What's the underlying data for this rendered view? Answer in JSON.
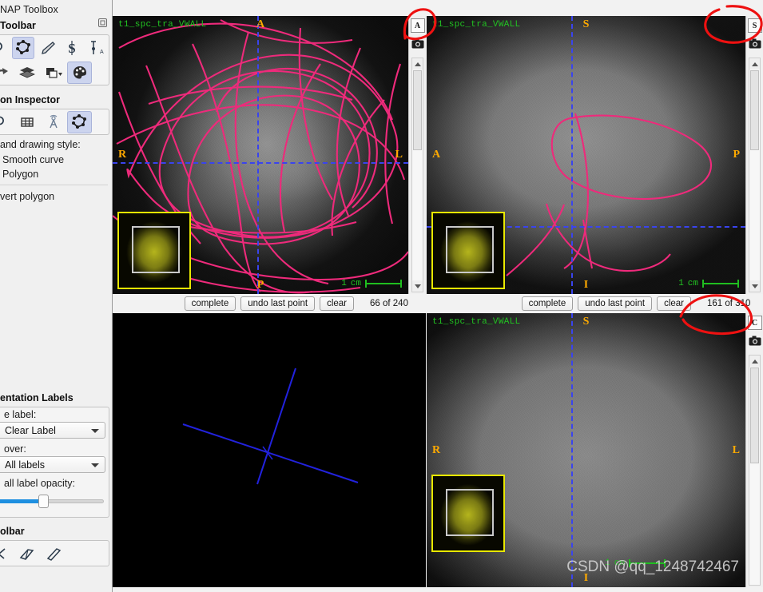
{
  "left_panel": {
    "window_title": "NAP Toolbox",
    "main_toolbar_header": "Toolbar",
    "main_toolbar_tools": [
      {
        "name": "crosshair-zoom-tool",
        "icon": "magnifier-icon",
        "selected": false
      },
      {
        "name": "polygon-tool",
        "icon": "polygon-icon",
        "selected": true
      },
      {
        "name": "paintbrush-tool",
        "icon": "paintbrush-icon",
        "selected": false
      },
      {
        "name": "snake-tool",
        "icon": "snake-s-icon",
        "selected": false
      },
      {
        "name": "annotation-tool",
        "icon": "ruler-ab-icon",
        "selected": false
      }
    ],
    "main_toolbar_tools_row2": [
      {
        "name": "redo-button",
        "icon": "arrow-right-icon",
        "selected": false
      },
      {
        "name": "layers-button",
        "icon": "layers-icon",
        "selected": false
      },
      {
        "name": "layout-button",
        "icon": "copy-dropdown-icon",
        "selected": false
      },
      {
        "name": "palette-button",
        "icon": "palette-icon",
        "selected": true
      }
    ],
    "inspector_header": "on Inspector",
    "inspector_tabs": [
      {
        "name": "inspector-tab-zoom",
        "icon": "magnifier-icon",
        "selected": false
      },
      {
        "name": "inspector-tab-grid",
        "icon": "grid-icon",
        "selected": false
      },
      {
        "name": "inspector-tab-contrast",
        "icon": "antenna-icon",
        "selected": false
      },
      {
        "name": "inspector-tab-polygon",
        "icon": "polygon-icon",
        "selected": true
      }
    ],
    "drawing_style_label": "and drawing style:",
    "radio_smooth": "Smooth curve",
    "radio_polygon": "Polygon",
    "invert_polygon": "vert polygon",
    "labels_header": "entation Labels",
    "active_label_caption": "e label:",
    "active_label_value": "Clear Label",
    "paint_over_caption": "over:",
    "paint_over_value": "All labels",
    "opacity_caption": "all label opacity:",
    "opacity_percent": 47,
    "bottom_toolbar_header": "olbar",
    "bottom_tools": [
      {
        "name": "crosshair-3d-tool",
        "icon": "crosshair-icon"
      },
      {
        "name": "scalpel-tool",
        "icon": "scalpel-icon"
      },
      {
        "name": "spray-tool",
        "icon": "spray-icon"
      }
    ]
  },
  "views": {
    "axial": {
      "image_label": "t1_spc_tra_VWALL",
      "orientation": {
        "top": "A",
        "bottom": "P",
        "left": "R",
        "right": "L"
      },
      "scale_text": "1",
      "scale_unit": "cm",
      "strip_letter": "A",
      "camera_icon": "camera-icon",
      "slice_counter": "66 of 240",
      "buttons": {
        "complete": "complete",
        "undo": "undo last point",
        "clear": "clear"
      }
    },
    "sagittal": {
      "image_label": "t1_spc_tra_VWALL",
      "orientation": {
        "top": "S",
        "bottom": "I",
        "left": "A",
        "right": "P"
      },
      "scale_text": "1",
      "scale_unit": "cm",
      "strip_letter": "S",
      "camera_icon": "camera-icon",
      "slice_counter": "161 of 310",
      "buttons": {
        "complete": "complete",
        "undo": "undo last point",
        "clear": "clear"
      }
    },
    "three_d": {
      "name": "3d-render-view"
    },
    "coronal": {
      "image_label": "t1_spc_tra_VWALL",
      "orientation": {
        "top": "S",
        "bottom": "I",
        "left": "R",
        "right": "L"
      },
      "scale_text": "1",
      "scale_unit": "cm",
      "strip_letter": "C",
      "camera_icon": "camera-icon"
    }
  },
  "annotations": {
    "watermark": "CSDN @qq_1248742467",
    "highlight_color": "#ee1111",
    "circles": [
      "axial-strip-letter-circle",
      "sagittal-strip-letter-circle",
      "sagittal-slice-counter-circle"
    ]
  },
  "colors": {
    "image_label_green": "#22c322",
    "orientation_orange": "#ffaa00",
    "crosshair_blue": "#3a44ee",
    "contour_pink": "#ee2a7b",
    "thumbnail_yellow": "#e8e800",
    "selection_blue": "#ccd4ee"
  }
}
